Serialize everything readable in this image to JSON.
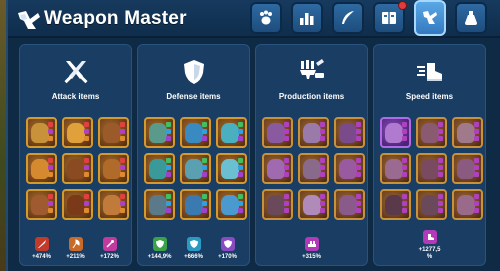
{
  "title": "Weapon Master",
  "tabs": [
    {
      "name": "paw-icon",
      "active": false
    },
    {
      "name": "bar-chart-icon",
      "active": false
    },
    {
      "name": "feather-icon",
      "active": false
    },
    {
      "name": "book-icon",
      "active": false,
      "notification": true
    },
    {
      "name": "weapon-master-icon",
      "active": true
    },
    {
      "name": "potion-icon",
      "active": false
    }
  ],
  "categories": [
    {
      "title": "Attack items",
      "icon": "crossed-swords-icon",
      "stats": [
        {
          "icon": "sword-icon",
          "color": "#c23a2a",
          "value": "+474%"
        },
        {
          "icon": "axe-icon",
          "color": "#c86a2a",
          "value": "+211%"
        },
        {
          "icon": "wand-icon",
          "color": "#c23aa0",
          "value": "+172%"
        }
      ]
    },
    {
      "title": "Defense items",
      "icon": "shield-icon",
      "stats": [
        {
          "icon": "green-shield-icon",
          "color": "#3aa24a",
          "value": "+144,9%"
        },
        {
          "icon": "cyan-shield-icon",
          "color": "#2a9ac2",
          "value": "+666%"
        },
        {
          "icon": "purple-shield-icon",
          "color": "#8a4ac2",
          "value": "+170%"
        }
      ]
    },
    {
      "title": "Production items",
      "icon": "hammer-anvil-icon",
      "stats": [
        {
          "icon": "production-icon",
          "color": "#b03ab8",
          "value": "+315%"
        }
      ]
    },
    {
      "title": "Speed items",
      "icon": "winged-boot-icon",
      "stats": [
        {
          "icon": "speed-boot-icon",
          "color": "#b03ab8",
          "value": "+1277,5 %"
        }
      ]
    }
  ],
  "colors": {
    "panel_bg": "#0f2a45",
    "category_bg": "#1a3d63",
    "slot_border": "#d59a2c",
    "epic_border": "#b06ae8",
    "tab_active": "#5aa8e6"
  }
}
